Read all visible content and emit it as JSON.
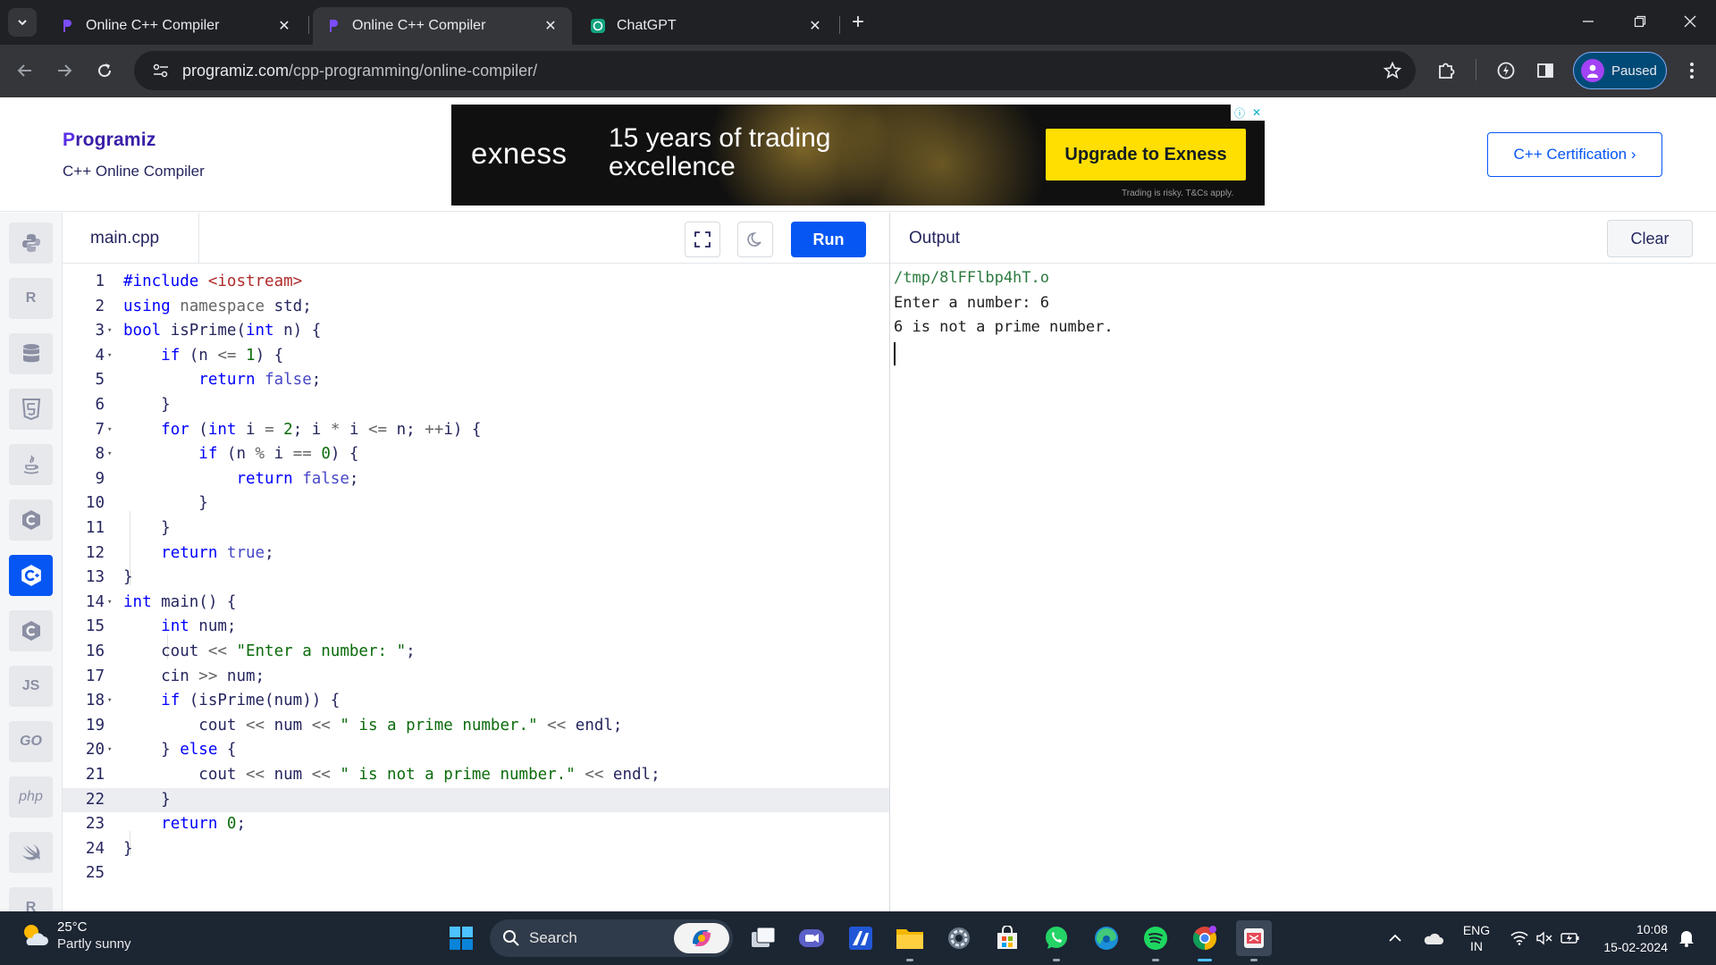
{
  "browser": {
    "tabs": [
      {
        "title": "Online C++ Compiler",
        "favicon": "programiz-icon",
        "active": false
      },
      {
        "title": "Online C++ Compiler",
        "favicon": "programiz-icon",
        "active": true
      },
      {
        "title": "ChatGPT",
        "favicon": "chatgpt-icon",
        "active": false
      }
    ],
    "url_host": "programiz.com",
    "url_path": "/cpp-programming/online-compiler/",
    "profile_label": "Paused"
  },
  "header": {
    "logo_text": "rogramiz",
    "logo_initial": "P",
    "subtitle": "C++ Online Compiler",
    "certification_button": "C++ Certification ›"
  },
  "ad": {
    "brand": "exness",
    "headline": "15 years of trading excellence",
    "cta": "Upgrade to Exness",
    "disclaimer": "Trading is risky. T&Cs apply."
  },
  "sidebar": {
    "languages": [
      {
        "name": "python-icon",
        "glyph": ""
      },
      {
        "name": "r-icon",
        "glyph": "R"
      },
      {
        "name": "sql-icon",
        "glyph": ""
      },
      {
        "name": "html-icon",
        "glyph": "5"
      },
      {
        "name": "java-icon",
        "glyph": ""
      },
      {
        "name": "c-icon",
        "glyph": "C"
      },
      {
        "name": "cpp-icon",
        "glyph": "C+"
      },
      {
        "name": "csharp-icon",
        "glyph": "C#"
      },
      {
        "name": "js-icon",
        "glyph": "JS"
      },
      {
        "name": "go-icon",
        "glyph": "GO"
      },
      {
        "name": "php-icon",
        "glyph": "php"
      },
      {
        "name": "swift-icon",
        "glyph": ""
      },
      {
        "name": "rust-icon",
        "glyph": "R"
      }
    ]
  },
  "editor": {
    "file_name": "main.cpp",
    "run_label": "Run",
    "current_line": 22,
    "lines": [
      "#include <iostream>",
      "using namespace std;",
      "bool isPrime(int n) {",
      "    if (n <= 1) {",
      "        return false;",
      "    }",
      "    for (int i = 2; i * i <= n; ++i) {",
      "        if (n % i == 0) {",
      "            return false;",
      "        }",
      "    }",
      "    return true;",
      "}",
      "int main() {",
      "    int num;",
      "    cout << \"Enter a number: \";",
      "    cin >> num;",
      "    if (isPrime(num)) {",
      "        cout << num << \" is a prime number.\" << endl;",
      "    } else {",
      "        cout << num << \" is not a prime number.\" << endl;",
      "    }",
      "    return 0;",
      "}",
      ""
    ],
    "foldable_lines": [
      3,
      4,
      7,
      8,
      14,
      18,
      20
    ]
  },
  "output": {
    "title": "Output",
    "clear_label": "Clear",
    "lines": [
      "/tmp/8lFFlbp4hT.o",
      "Enter a number: 6",
      "6 is not a prime number."
    ]
  },
  "taskbar": {
    "weather_temp": "25°C",
    "weather_condition": "Partly sunny",
    "search_label": "Search",
    "lang_top": "ENG",
    "lang_bottom": "IN",
    "time": "10:08",
    "date": "15-02-2024"
  }
}
